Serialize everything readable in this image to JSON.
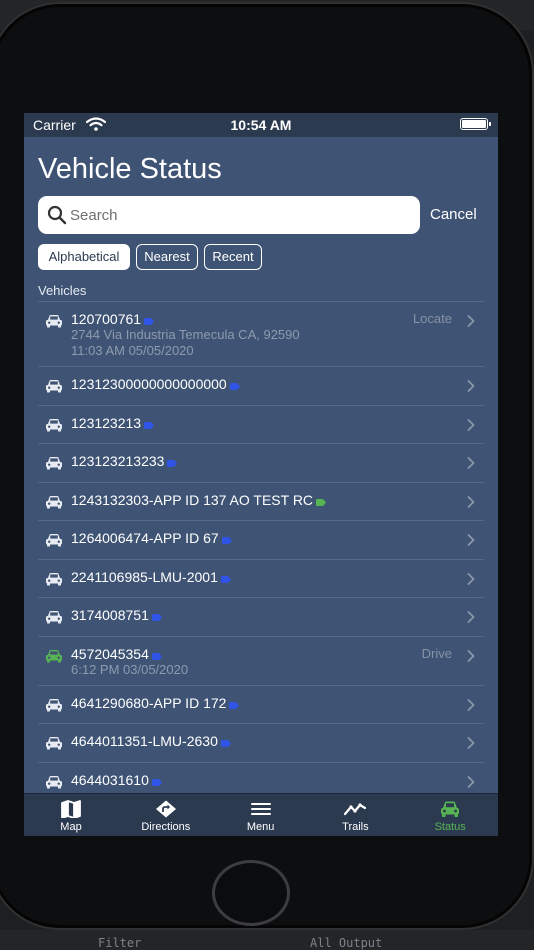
{
  "status_bar": {
    "carrier": "Carrier",
    "time": "10:54 AM"
  },
  "header": {
    "title": "Vehicle Status"
  },
  "search": {
    "placeholder": "Search",
    "value": "",
    "cancel_label": "Cancel"
  },
  "sort": {
    "alphabetical": "Alphabetical",
    "nearest": "Nearest",
    "recent": "Recent",
    "selected": "Alphabetical"
  },
  "section": {
    "label": "Vehicles"
  },
  "colors": {
    "tag_blue": "#2f54e6",
    "tag_green": "#57b452",
    "active_tab": "#57b452",
    "background": "#3f5474",
    "bars": "#2c3a50"
  },
  "vehicles": [
    {
      "name": "120700761",
      "tag": "blue",
      "address": "2744 Via Industria Temecula CA, 92590",
      "timestamp": "11:03 AM 05/05/2020",
      "action": "Locate",
      "icon": "car-icon"
    },
    {
      "name": "12312300000000000000",
      "tag": "blue",
      "icon": "car-icon"
    },
    {
      "name": "123123213",
      "tag": "blue",
      "icon": "car-icon"
    },
    {
      "name": "123123213233",
      "tag": "blue",
      "icon": "car-icon"
    },
    {
      "name": "1243132303-APP ID 137 AO TEST RC",
      "tag": "green",
      "icon": "car-icon"
    },
    {
      "name": "1264006474-APP ID 67",
      "tag": "blue",
      "icon": "car-icon"
    },
    {
      "name": "2241106985-LMU-2001",
      "tag": "blue",
      "icon": "car-icon"
    },
    {
      "name": "3174008751",
      "tag": "blue",
      "icon": "car-icon"
    },
    {
      "name": "4572045354",
      "tag": "blue",
      "timestamp": "6:12 PM 03/05/2020",
      "action": "Drive",
      "icon": "car-icon"
    },
    {
      "name": "4641290680-APP ID 172",
      "tag": "blue",
      "icon": "car-icon"
    },
    {
      "name": "4644011351-LMU-2630",
      "tag": "blue",
      "icon": "car-icon"
    },
    {
      "name": "4644031610",
      "tag": "blue",
      "icon": "car-icon"
    }
  ],
  "tabs": [
    {
      "label": "Map",
      "icon": "map-icon"
    },
    {
      "label": "Directions",
      "icon": "directions-icon"
    },
    {
      "label": "Menu",
      "icon": "menu-icon"
    },
    {
      "label": "Trails",
      "icon": "trails-icon"
    },
    {
      "label": "Status",
      "icon": "car-icon",
      "active": true
    }
  ],
  "background_window": {
    "filter_label": "Filter",
    "output_label": "All Output"
  }
}
